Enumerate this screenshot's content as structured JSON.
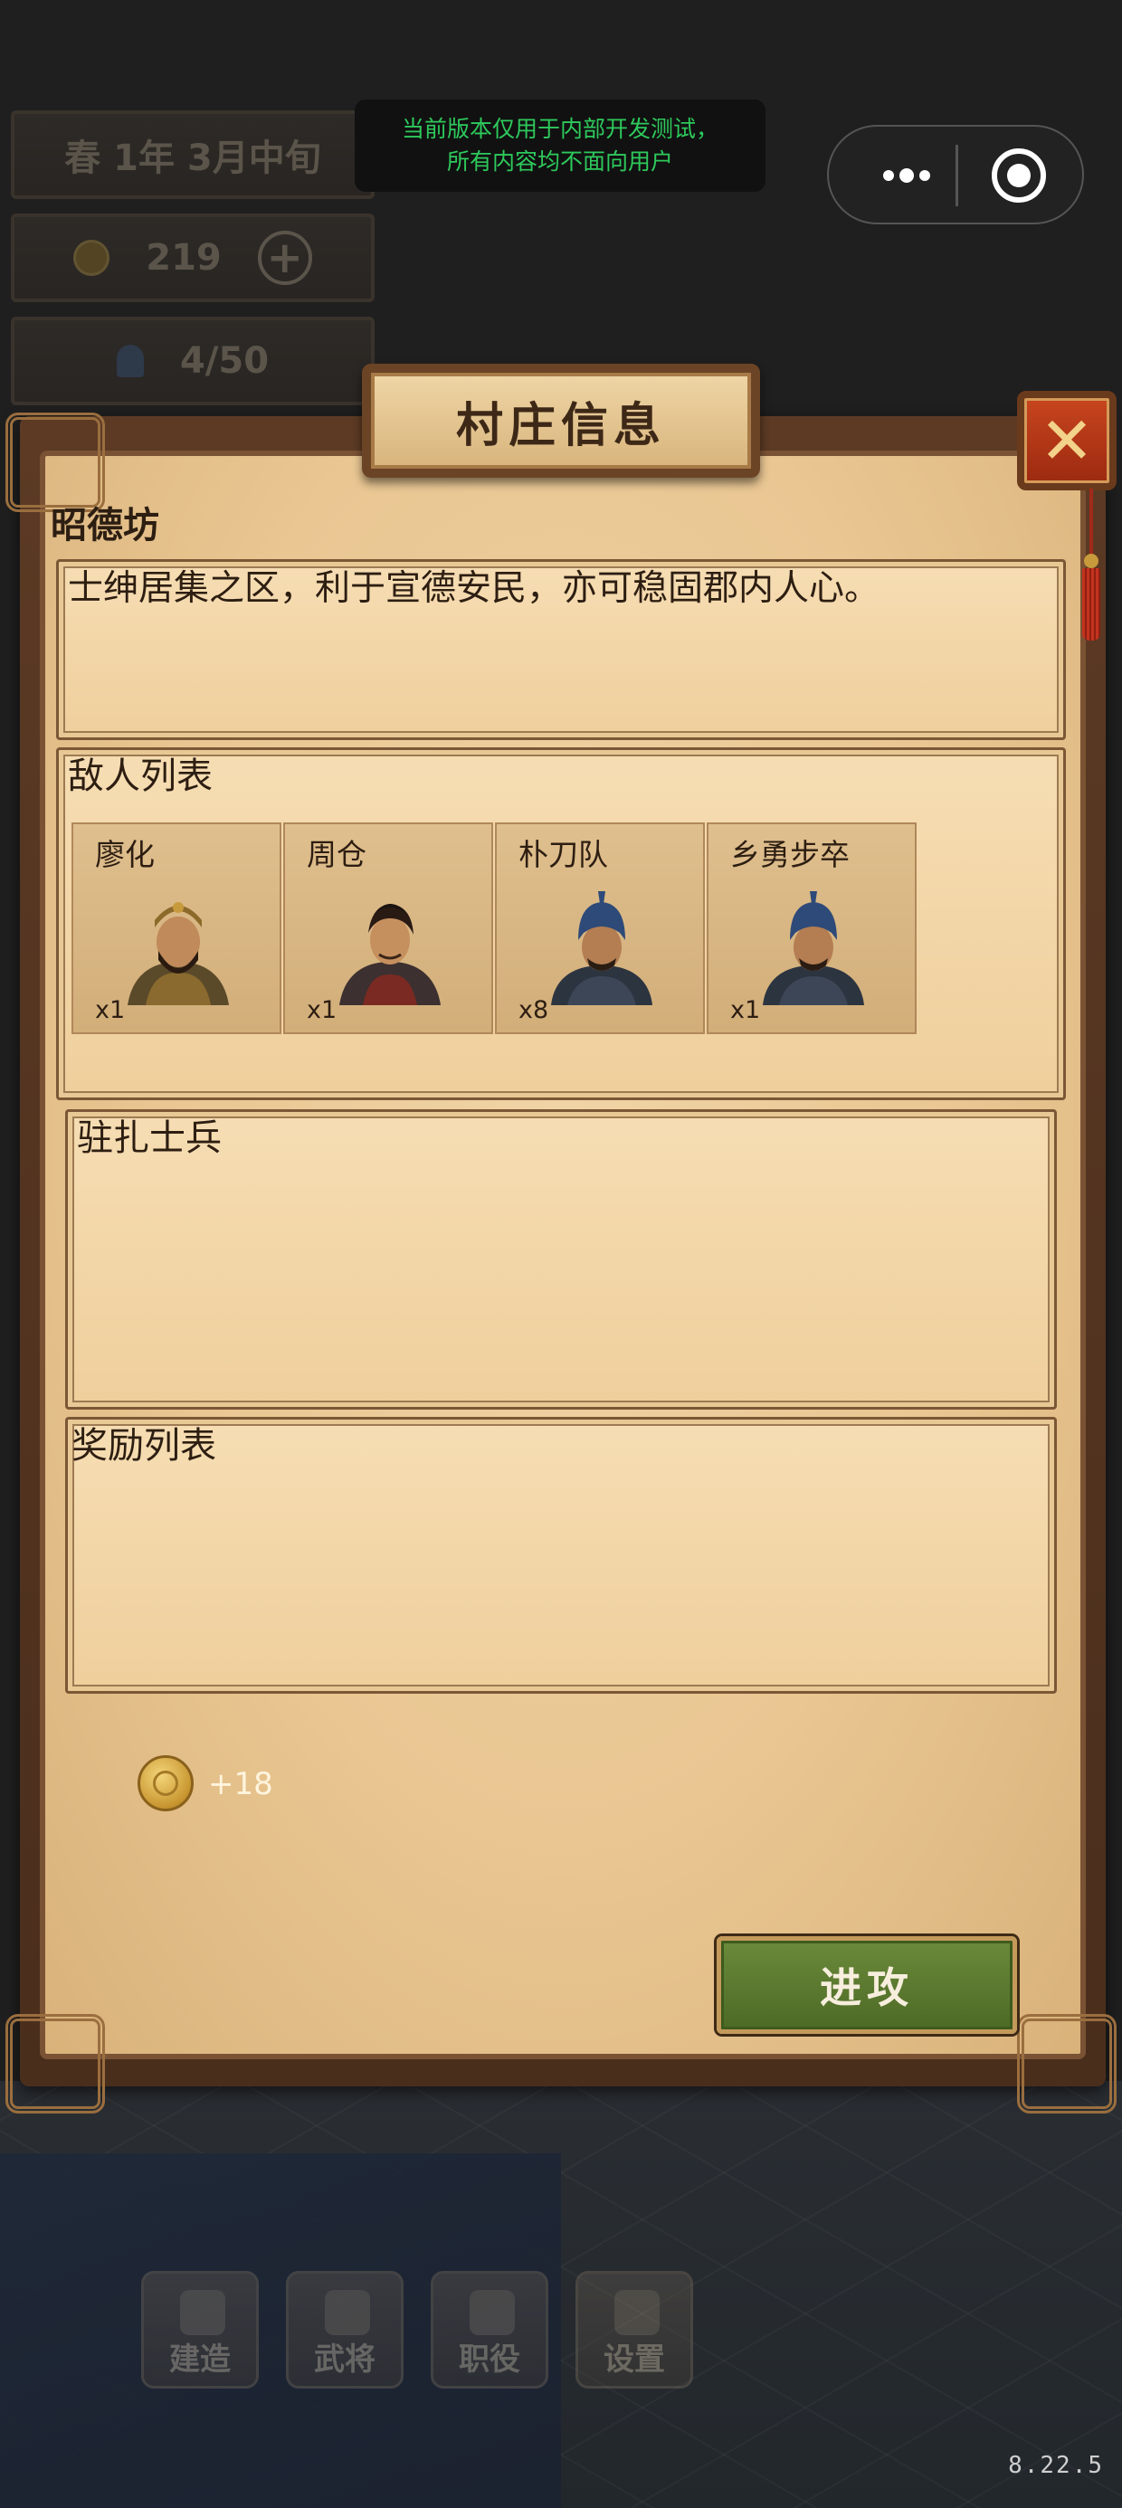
{
  "dev_notice": {
    "line1": "当前版本仅用于内部开发测试，",
    "line2": "所有内容均不面向用户"
  },
  "status_bar": {
    "date": "春  1年  3月中旬",
    "gold": "219",
    "population": "4/50"
  },
  "dialog": {
    "title": "村庄信息",
    "village_name": "昭德坊",
    "description": "士绅居集之区，利于宣德安民，亦可稳固郡内人心。",
    "enemies": {
      "header": "敌人列表",
      "items": [
        {
          "name": "廖化",
          "count": "x1"
        },
        {
          "name": "周仓",
          "count": "x1"
        },
        {
          "name": "朴刀队",
          "count": "x8"
        },
        {
          "name": "乡勇步卒",
          "count": "x1"
        }
      ]
    },
    "garrison": {
      "header": "驻扎士兵"
    },
    "rewards": {
      "header": "奖励列表",
      "gold": "+18"
    },
    "attack_label": "进攻",
    "close_icon": "close-icon"
  },
  "bottom_nav": {
    "items": [
      {
        "label": "建造",
        "icon": "hammer-icon"
      },
      {
        "label": "武将",
        "icon": "generals-icon"
      },
      {
        "label": "职役",
        "icon": "worker-icon"
      },
      {
        "label": "设置",
        "icon": "gear-icon"
      }
    ]
  },
  "version": "8.22.5",
  "colors": {
    "parchment": "#efcf9c",
    "frame": "#5c3a24",
    "attack_button": "#5b7a30",
    "close_button": "#b8391a",
    "notice_text": "#2ec95c"
  }
}
